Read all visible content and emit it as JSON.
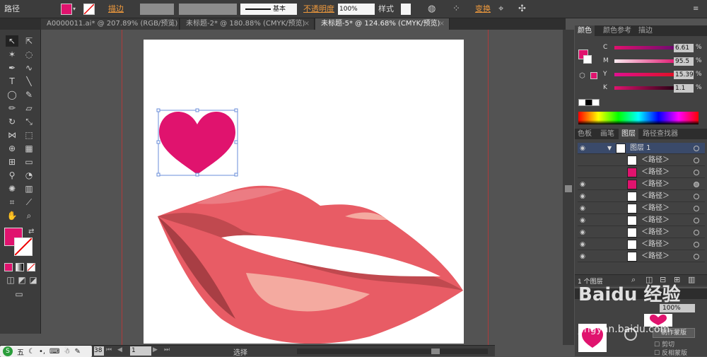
{
  "control": {
    "object_type": "路径",
    "stroke_label": "描边",
    "stroke_style": "基本",
    "opacity_label": "不透明度",
    "opacity_value": "100%",
    "style_label": "样式",
    "transform_label": "变换"
  },
  "tabs": [
    {
      "label": "A0000011.ai* @ 207.89% (RGB/预览)",
      "active": false
    },
    {
      "label": "未标题-2* @ 180.88% (CMYK/预览)",
      "active": false
    },
    {
      "label": "未标题-5* @ 124.68% (CMYK/预览)",
      "active": true
    }
  ],
  "close_glyph": "×",
  "color_panel": {
    "tabs": [
      "颜色",
      "颜色参考",
      "描边"
    ],
    "channels": [
      {
        "name": "C",
        "value": "6.61"
      },
      {
        "name": "M",
        "value": "95.5"
      },
      {
        "name": "Y",
        "value": "15.39"
      },
      {
        "name": "K",
        "value": "1.1"
      }
    ],
    "unit": "%"
  },
  "layers_panel": {
    "tabs": [
      "色板",
      "画笔",
      "图层",
      "路径查找器"
    ],
    "layer_name": "图层 1",
    "items": [
      "＜路径＞",
      "＜路径＞",
      "＜路径＞",
      "＜路径＞",
      "＜路径＞",
      "＜路径＞",
      "＜路径＞",
      "＜路径＞",
      "＜路径＞"
    ],
    "footer": "1 个图层"
  },
  "transparency_panel": {
    "opacity": "100%",
    "make_mask": "制作蒙版",
    "clip": "剪切",
    "invert": "反相蒙版"
  },
  "status": {
    "zoom": "38",
    "page": "1",
    "mode": "选择"
  },
  "ime": {
    "label": "五"
  },
  "watermark": "Baidu 经验",
  "watermark_url": "jingyan.baidu.com",
  "colors": {
    "fill": "#e0136e",
    "lip_main": "#e85c65",
    "lip_dark": "#c0494f",
    "lip_shade": "#a83e44",
    "lip_highlight": "#f4aaa0",
    "heart": "#e0136e"
  }
}
